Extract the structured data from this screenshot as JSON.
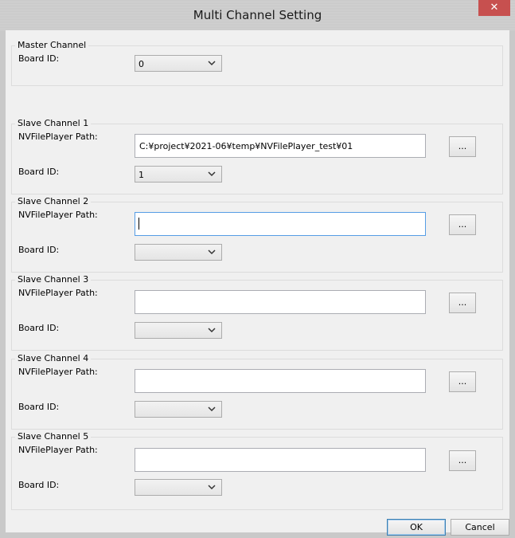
{
  "window": {
    "title": "Multi Channel Setting",
    "close_glyph": "✕"
  },
  "master": {
    "legend": "Master Channel",
    "board_label": "Board ID:",
    "board_value": "0"
  },
  "slaves": [
    {
      "legend": "Slave Channel 1",
      "path_label": "NVFilePlayer Path:",
      "path_value": "C:¥project¥2021-06¥temp¥NVFilePlayer_test¥01",
      "browse": "...",
      "board_label": "Board ID:",
      "board_value": "1"
    },
    {
      "legend": "Slave Channel 2",
      "path_label": "NVFilePlayer Path:",
      "path_value": "",
      "browse": "...",
      "board_label": "Board ID:",
      "board_value": ""
    },
    {
      "legend": "Slave Channel 3",
      "path_label": "NVFilePlayer Path:",
      "path_value": "",
      "browse": "...",
      "board_label": "Board ID:",
      "board_value": ""
    },
    {
      "legend": "Slave Channel 4",
      "path_label": "NVFilePlayer Path:",
      "path_value": "",
      "browse": "...",
      "board_label": "Board ID:",
      "board_value": ""
    },
    {
      "legend": "Slave Channel 5",
      "path_label": "NVFilePlayer Path:",
      "path_value": "",
      "browse": "...",
      "board_label": "Board ID:",
      "board_value": ""
    }
  ],
  "buttons": {
    "ok": "OK",
    "cancel": "Cancel"
  },
  "colors": {
    "close_bg": "#c7504f",
    "focus_border": "#569de5"
  },
  "icons": {
    "dropdown": "chevron-down-icon",
    "close": "close-icon"
  }
}
